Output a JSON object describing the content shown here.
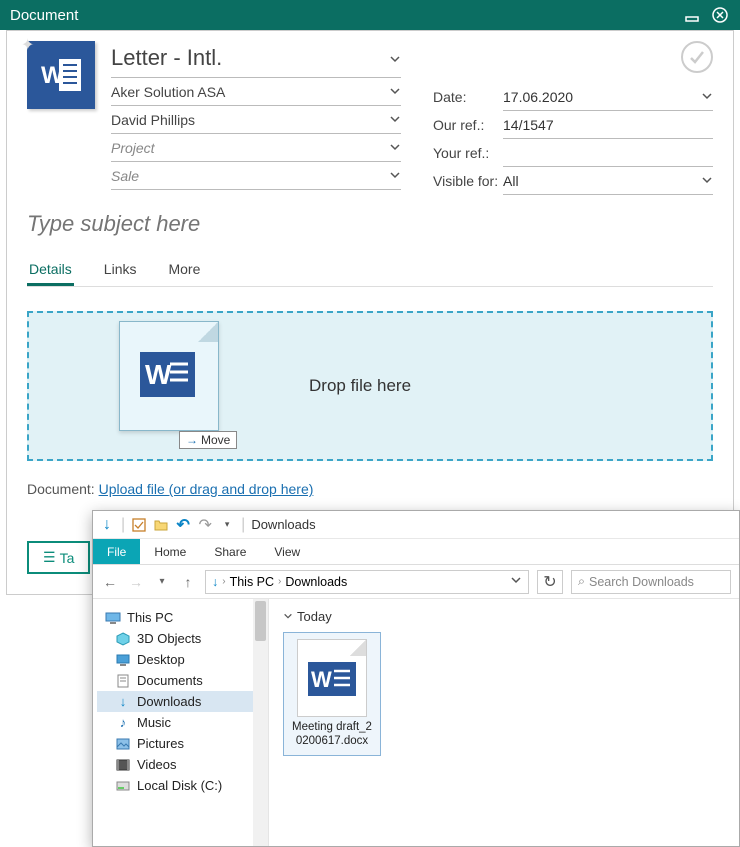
{
  "window": {
    "title": "Document"
  },
  "template": {
    "name": "Letter - Intl."
  },
  "fields": {
    "company": "Aker Solution ASA",
    "contact": "David Phillips",
    "project_placeholder": "Project",
    "sale_placeholder": "Sale"
  },
  "meta": {
    "date_label": "Date:",
    "date_value": "17.06.2020",
    "ourref_label": "Our ref.:",
    "ourref_value": "14/1547",
    "yourref_label": "Your ref.:",
    "yourref_value": "",
    "visible_label": "Visible for:",
    "visible_value": "All"
  },
  "subject_placeholder": "Type subject here",
  "tabs": {
    "details": "Details",
    "links": "Links",
    "more": "More"
  },
  "dropzone": {
    "text": "Drop file here",
    "move_badge": "Move"
  },
  "docline": {
    "label": "Document:",
    "link": "Upload file (or drag and drop here)"
  },
  "taskbtn": "Ta",
  "explorer": {
    "title": "Downloads",
    "ribbon": {
      "file": "File",
      "home": "Home",
      "share": "Share",
      "view": "View"
    },
    "breadcrumb": {
      "root": "This PC",
      "folder": "Downloads"
    },
    "search_placeholder": "Search Downloads",
    "tree": {
      "thispc": "This PC",
      "objects3d": "3D Objects",
      "desktop": "Desktop",
      "documents": "Documents",
      "downloads": "Downloads",
      "music": "Music",
      "pictures": "Pictures",
      "videos": "Videos",
      "localdisk": "Local Disk (C:)"
    },
    "group": "Today",
    "file": {
      "name": "Meeting draft_20200617.docx"
    }
  }
}
